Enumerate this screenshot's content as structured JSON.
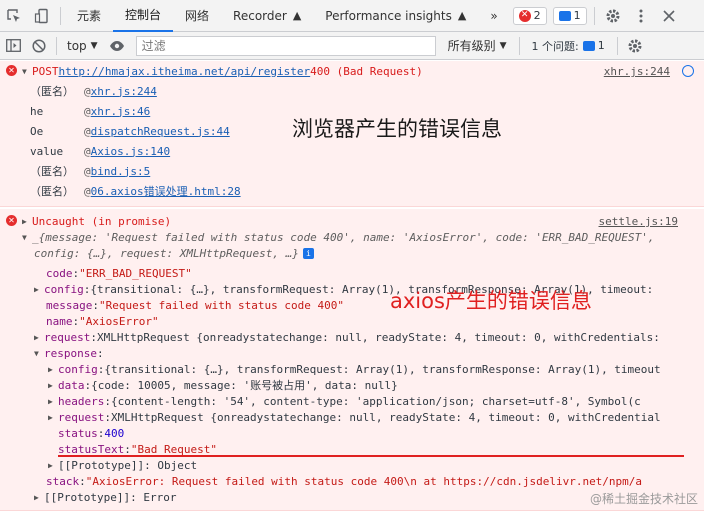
{
  "toolbar": {
    "tabs": [
      "元素",
      "控制台",
      "网络",
      "Recorder",
      "Performance insights"
    ],
    "recorder_suffix": "▲",
    "perf_suffix": "▲",
    "more": "»",
    "error_count": "2",
    "message_count": "1",
    "filter_placeholder": "过滤",
    "context": "top",
    "levels": "所有级别",
    "issues": "1 个问题:",
    "issues_count": "1"
  },
  "error1": {
    "header": {
      "method": "POST",
      "url": "http://hmajax.itheima.net/api/register",
      "status": "400 (Bad Request)",
      "source": "xhr.js:244"
    },
    "stack": [
      {
        "fn": "（匿名）",
        "loc": "xhr.js:244"
      },
      {
        "fn": "he",
        "loc": "xhr.js:46"
      },
      {
        "fn": "Oe",
        "loc": "dispatchRequest.js:44"
      },
      {
        "fn": "value",
        "loc": "Axios.js:140"
      },
      {
        "fn": "（匿名）",
        "loc": "bind.js:5"
      },
      {
        "fn": "（匿名）",
        "loc": "06.axios错误处理.html:28"
      }
    ],
    "annotation": "浏览器产生的错误信息"
  },
  "error2": {
    "header": "Uncaught (in promise)",
    "source": "settle.js:19",
    "summary1": "{message: 'Request failed with status code 400', name: 'AxiosError', code: 'ERR_BAD_REQUEST',",
    "summary2": "config: {…}, request: XMLHttpRequest, …}",
    "code_key": "code",
    "code_val": "\"ERR_BAD_REQUEST\"",
    "config_key": "config",
    "config_val": "{transitional: {…}, transformRequest: Array(1), transformResponse: Array(1), timeout:",
    "message_key": "message",
    "message_val": "\"Request failed with status code 400\"",
    "name_key": "name",
    "name_val": "\"AxiosError\"",
    "request_key": "request",
    "request_val": "XMLHttpRequest {onreadystatechange: null, readyState: 4, timeout: 0, withCredentials:",
    "response_key": "response",
    "r_config_key": "config",
    "r_config_val": "{transitional: {…}, transformRequest: Array(1), transformResponse: Array(1), timeout",
    "r_data_key": "data",
    "r_data_val": "{code: 10005, message: '账号被占用', data: null}",
    "r_headers_key": "headers",
    "r_headers_val": "{content-length: '54', content-type: 'application/json; charset=utf-8', Symbol(c",
    "r_request_key": "request",
    "r_request_val": "XMLHttpRequest {onreadystatechange: null, readyState: 4, timeout: 0, withCredential",
    "r_status_key": "status",
    "r_status_val": "400",
    "r_statustext_key": "statusText",
    "r_statustext_val": "\"Bad Request\"",
    "r_proto": "[[Prototype]]: Object",
    "stack_key": "stack",
    "stack_val": "\"AxiosError: Request failed with status code 400\\n    at https://cdn.jsdelivr.net/npm/a",
    "proto": "[[Prototype]]: Error",
    "annotation": "axios产生的错误信息"
  },
  "watermark": "@稀土掘金技术社区",
  "colors": {
    "accent": "#1a73e8",
    "error": "#e52d2d",
    "annotation_red": "#e02020"
  }
}
